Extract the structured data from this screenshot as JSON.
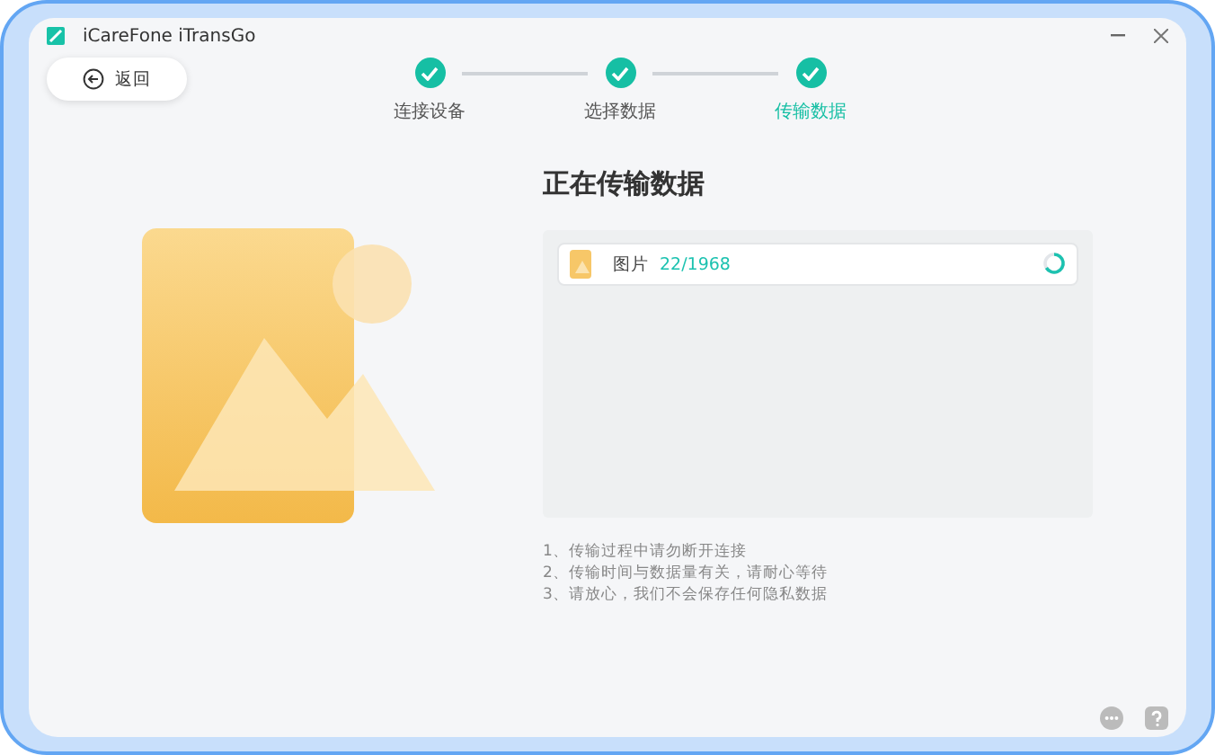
{
  "window": {
    "title": "iCareFone iTransGo"
  },
  "back_button": {
    "label": "返回"
  },
  "steps": [
    {
      "label": "连接设备",
      "done": true,
      "selected": false
    },
    {
      "label": "选择数据",
      "done": true,
      "selected": false
    },
    {
      "label": "传输数据",
      "done": true,
      "selected": true
    }
  ],
  "heading": "正在传输数据",
  "transfers": [
    {
      "name": "图片",
      "count": "22/1968",
      "in_progress": true
    }
  ],
  "notes": [
    "1、传输过程中请勿断开连接",
    "2、传输时间与数据量有关，请耐心等待",
    "3、请放心，我们不会保存任何隐私数据"
  ]
}
